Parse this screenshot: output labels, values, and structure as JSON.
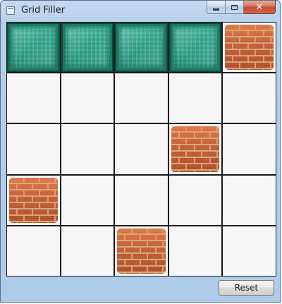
{
  "window": {
    "title": "Grid Filler",
    "icon": "window-app-icon",
    "caption": {
      "minimize_icon": "minimize-icon",
      "maximize_icon": "maximize-icon",
      "close_glyph": "✕",
      "close_icon": "close-icon"
    }
  },
  "grid": {
    "rows": 5,
    "columns": 5,
    "cells": [
      [
        "glass",
        "glass",
        "glass",
        "glass",
        "brick"
      ],
      [
        "empty",
        "empty",
        "empty",
        "empty",
        "empty"
      ],
      [
        "empty",
        "empty",
        "empty",
        "brick",
        "empty"
      ],
      [
        "brick",
        "empty",
        "empty",
        "empty",
        "empty"
      ],
      [
        "empty",
        "empty",
        "brick",
        "empty",
        "empty"
      ]
    ]
  },
  "footer": {
    "reset_label": "Reset"
  },
  "colors": {
    "glass_tile": "#2b9d84",
    "brick_tile": "#c9613a",
    "empty_cell": "#f6f6f6",
    "grid_lines": "#1b1b1b"
  }
}
